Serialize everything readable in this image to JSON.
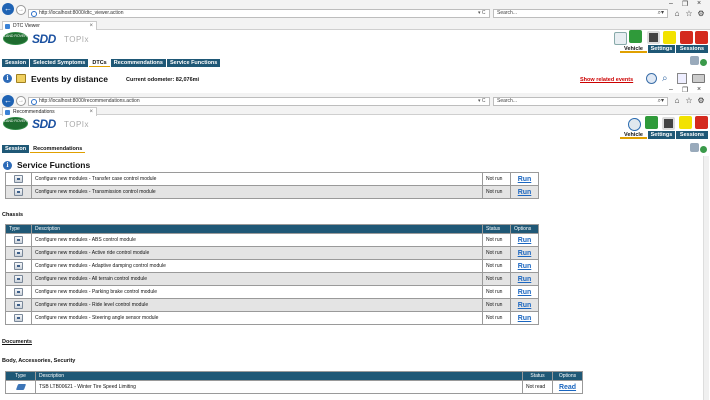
{
  "outer_browser": {
    "url": "http://localhost:8000/dtc_viewer.action",
    "search_placeholder": "Search...",
    "tab_title": "DTC Viewer"
  },
  "outer_app": {
    "brand": "LAND ROVER",
    "product": "SDD",
    "subtitle": "TOPIx",
    "header_buttons": [
      "Vehicle",
      "Settings",
      "Sessions"
    ],
    "menu": [
      "Session",
      "Selected Symptoms",
      "DTCs",
      "Recommendations",
      "Service Functions"
    ],
    "active_menu": "DTCs",
    "page_title": "Events by distance",
    "odometer": "Current odometer: 82,076mi",
    "related_link": "Show related events"
  },
  "inner_browser": {
    "url": "http://localhost:8000/recommendations.action",
    "search_placeholder": "Search...",
    "tab_title": "Recommendations"
  },
  "inner_app": {
    "brand": "LAND ROVER",
    "product": "SDD",
    "subtitle": "TOPIx",
    "header_buttons": [
      "Vehicle",
      "Settings",
      "Sessions"
    ],
    "menu": [
      "Session",
      "Recommendations"
    ],
    "active_menu": "Recommendations",
    "page_title": "Service Functions"
  },
  "top_rows": [
    {
      "description": "Configure new modules - Transfer case control module",
      "status": "Not run",
      "option": "Run"
    },
    {
      "description": "Configure new modules - Transmission control module",
      "status": "Not run",
      "option": "Run"
    }
  ],
  "chassis": {
    "heading": "Chassis",
    "columns": [
      "Type",
      "Description",
      "Status",
      "Options"
    ],
    "rows": [
      {
        "description": "Configure new modules - ABS control module",
        "status": "Not run",
        "option": "Run"
      },
      {
        "description": "Configure new modules - Active ride control module",
        "status": "Not run",
        "option": "Run"
      },
      {
        "description": "Configure new modules - Adaptive damping control module",
        "status": "Not run",
        "option": "Run"
      },
      {
        "description": "Configure new modules - All terrain control module",
        "status": "Not run",
        "option": "Run"
      },
      {
        "description": "Configure new modules - Parking brake control module",
        "status": "Not run",
        "option": "Run"
      },
      {
        "description": "Configure new modules - Ride level control module",
        "status": "Not run",
        "option": "Run"
      },
      {
        "description": "Configure new modules - Steering angle sensor module",
        "status": "Not run",
        "option": "Run"
      }
    ]
  },
  "documents": {
    "heading": "Documents",
    "subheading": "Body, Accessories, Security",
    "columns": [
      "Type",
      "Description",
      "Status",
      "Options"
    ],
    "rows": [
      {
        "description": "TSB LTB00621 - Winter Tire Speed Limiting",
        "status": "Not read",
        "option": "Read"
      }
    ]
  },
  "colors": {
    "nav_bar": "#1f5876",
    "link": "#1a66c0",
    "related_link": "#cc0000",
    "active_underline": "#e0a000"
  }
}
